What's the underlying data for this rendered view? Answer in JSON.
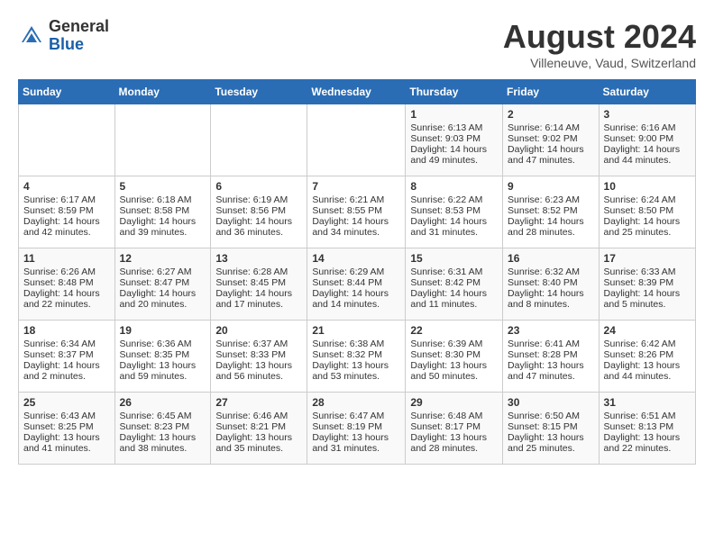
{
  "header": {
    "logo_general": "General",
    "logo_blue": "Blue",
    "month_title": "August 2024",
    "location": "Villeneuve, Vaud, Switzerland"
  },
  "days_of_week": [
    "Sunday",
    "Monday",
    "Tuesday",
    "Wednesday",
    "Thursday",
    "Friday",
    "Saturday"
  ],
  "weeks": [
    [
      {
        "day": "",
        "content": ""
      },
      {
        "day": "",
        "content": ""
      },
      {
        "day": "",
        "content": ""
      },
      {
        "day": "",
        "content": ""
      },
      {
        "day": "1",
        "content": "Sunrise: 6:13 AM\nSunset: 9:03 PM\nDaylight: 14 hours\nand 49 minutes."
      },
      {
        "day": "2",
        "content": "Sunrise: 6:14 AM\nSunset: 9:02 PM\nDaylight: 14 hours\nand 47 minutes."
      },
      {
        "day": "3",
        "content": "Sunrise: 6:16 AM\nSunset: 9:00 PM\nDaylight: 14 hours\nand 44 minutes."
      }
    ],
    [
      {
        "day": "4",
        "content": "Sunrise: 6:17 AM\nSunset: 8:59 PM\nDaylight: 14 hours\nand 42 minutes."
      },
      {
        "day": "5",
        "content": "Sunrise: 6:18 AM\nSunset: 8:58 PM\nDaylight: 14 hours\nand 39 minutes."
      },
      {
        "day": "6",
        "content": "Sunrise: 6:19 AM\nSunset: 8:56 PM\nDaylight: 14 hours\nand 36 minutes."
      },
      {
        "day": "7",
        "content": "Sunrise: 6:21 AM\nSunset: 8:55 PM\nDaylight: 14 hours\nand 34 minutes."
      },
      {
        "day": "8",
        "content": "Sunrise: 6:22 AM\nSunset: 8:53 PM\nDaylight: 14 hours\nand 31 minutes."
      },
      {
        "day": "9",
        "content": "Sunrise: 6:23 AM\nSunset: 8:52 PM\nDaylight: 14 hours\nand 28 minutes."
      },
      {
        "day": "10",
        "content": "Sunrise: 6:24 AM\nSunset: 8:50 PM\nDaylight: 14 hours\nand 25 minutes."
      }
    ],
    [
      {
        "day": "11",
        "content": "Sunrise: 6:26 AM\nSunset: 8:48 PM\nDaylight: 14 hours\nand 22 minutes."
      },
      {
        "day": "12",
        "content": "Sunrise: 6:27 AM\nSunset: 8:47 PM\nDaylight: 14 hours\nand 20 minutes."
      },
      {
        "day": "13",
        "content": "Sunrise: 6:28 AM\nSunset: 8:45 PM\nDaylight: 14 hours\nand 17 minutes."
      },
      {
        "day": "14",
        "content": "Sunrise: 6:29 AM\nSunset: 8:44 PM\nDaylight: 14 hours\nand 14 minutes."
      },
      {
        "day": "15",
        "content": "Sunrise: 6:31 AM\nSunset: 8:42 PM\nDaylight: 14 hours\nand 11 minutes."
      },
      {
        "day": "16",
        "content": "Sunrise: 6:32 AM\nSunset: 8:40 PM\nDaylight: 14 hours\nand 8 minutes."
      },
      {
        "day": "17",
        "content": "Sunrise: 6:33 AM\nSunset: 8:39 PM\nDaylight: 14 hours\nand 5 minutes."
      }
    ],
    [
      {
        "day": "18",
        "content": "Sunrise: 6:34 AM\nSunset: 8:37 PM\nDaylight: 14 hours\nand 2 minutes."
      },
      {
        "day": "19",
        "content": "Sunrise: 6:36 AM\nSunset: 8:35 PM\nDaylight: 13 hours\nand 59 minutes."
      },
      {
        "day": "20",
        "content": "Sunrise: 6:37 AM\nSunset: 8:33 PM\nDaylight: 13 hours\nand 56 minutes."
      },
      {
        "day": "21",
        "content": "Sunrise: 6:38 AM\nSunset: 8:32 PM\nDaylight: 13 hours\nand 53 minutes."
      },
      {
        "day": "22",
        "content": "Sunrise: 6:39 AM\nSunset: 8:30 PM\nDaylight: 13 hours\nand 50 minutes."
      },
      {
        "day": "23",
        "content": "Sunrise: 6:41 AM\nSunset: 8:28 PM\nDaylight: 13 hours\nand 47 minutes."
      },
      {
        "day": "24",
        "content": "Sunrise: 6:42 AM\nSunset: 8:26 PM\nDaylight: 13 hours\nand 44 minutes."
      }
    ],
    [
      {
        "day": "25",
        "content": "Sunrise: 6:43 AM\nSunset: 8:25 PM\nDaylight: 13 hours\nand 41 minutes."
      },
      {
        "day": "26",
        "content": "Sunrise: 6:45 AM\nSunset: 8:23 PM\nDaylight: 13 hours\nand 38 minutes."
      },
      {
        "day": "27",
        "content": "Sunrise: 6:46 AM\nSunset: 8:21 PM\nDaylight: 13 hours\nand 35 minutes."
      },
      {
        "day": "28",
        "content": "Sunrise: 6:47 AM\nSunset: 8:19 PM\nDaylight: 13 hours\nand 31 minutes."
      },
      {
        "day": "29",
        "content": "Sunrise: 6:48 AM\nSunset: 8:17 PM\nDaylight: 13 hours\nand 28 minutes."
      },
      {
        "day": "30",
        "content": "Sunrise: 6:50 AM\nSunset: 8:15 PM\nDaylight: 13 hours\nand 25 minutes."
      },
      {
        "day": "31",
        "content": "Sunrise: 6:51 AM\nSunset: 8:13 PM\nDaylight: 13 hours\nand 22 minutes."
      }
    ]
  ]
}
